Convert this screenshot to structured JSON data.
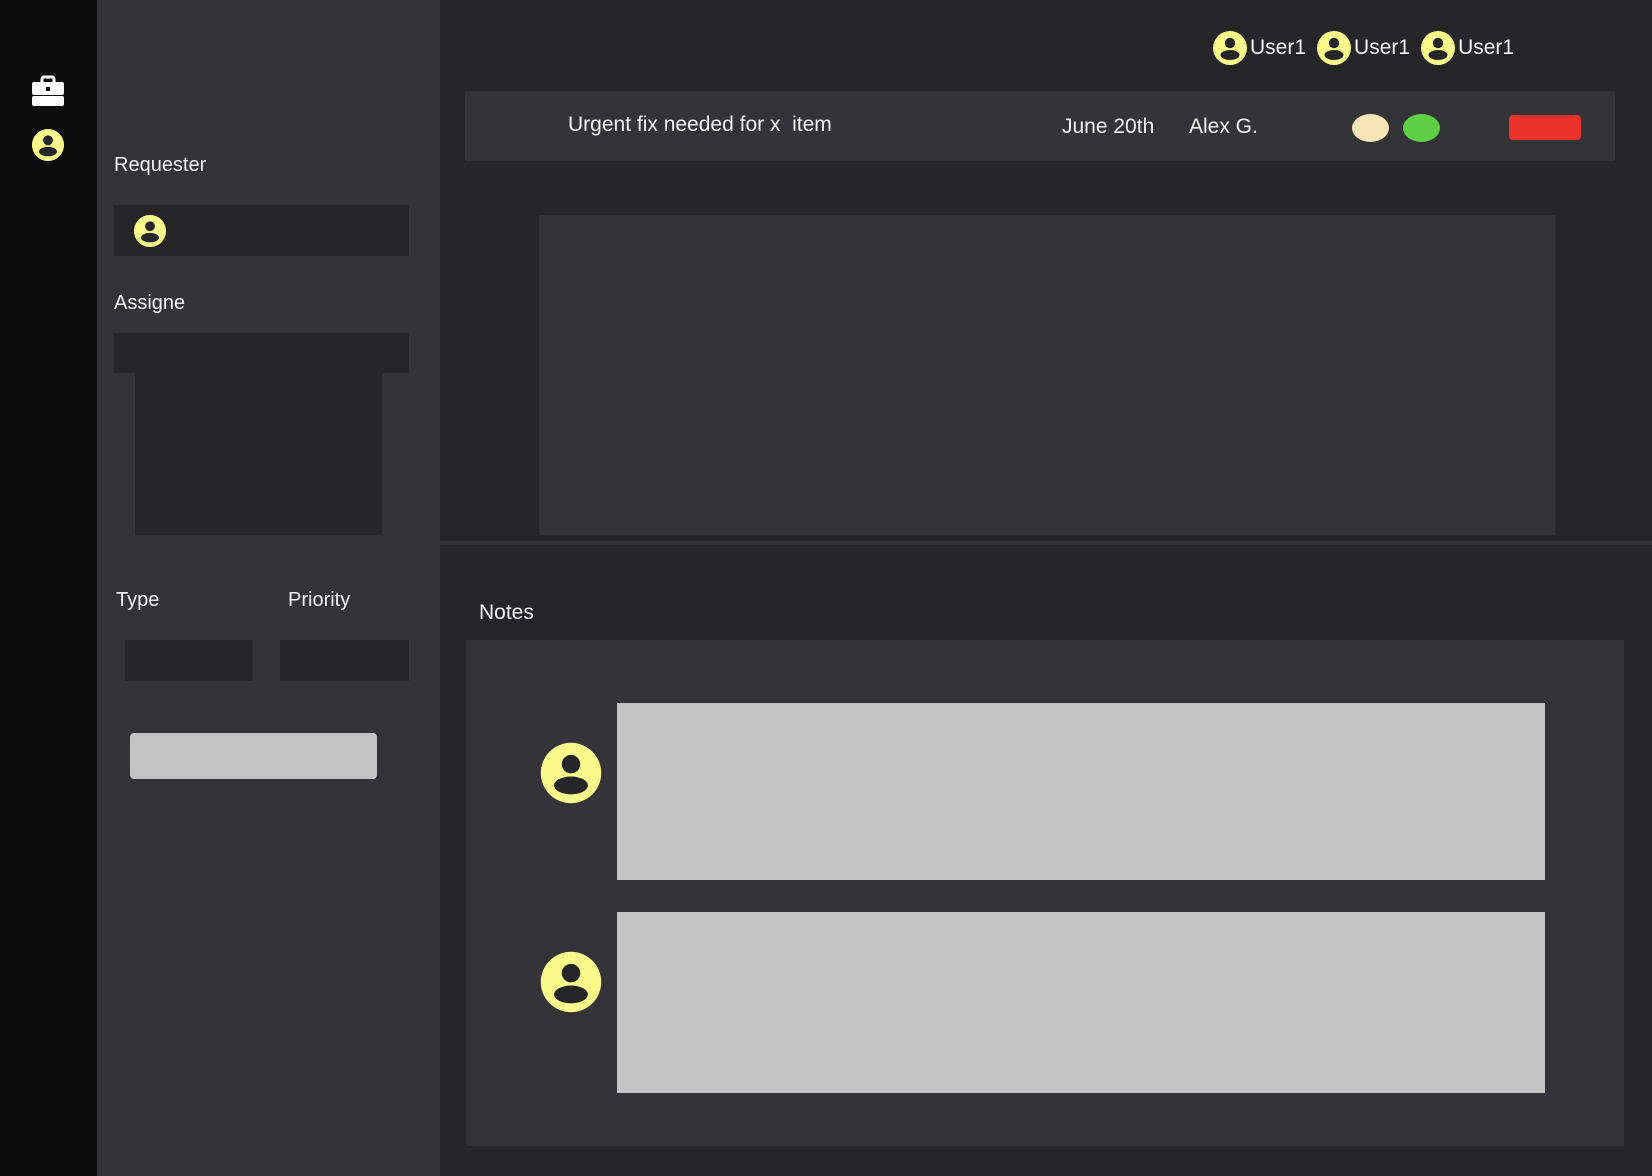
{
  "colors": {
    "rail_bg": "#0d0d0d",
    "panel_bg": "#343438",
    "canvas_bg": "#262629",
    "field_bg": "#262629",
    "avatar_yellow": "#fafa8c",
    "avatar_dark": "#262629",
    "status_cream": "#f7e6b5",
    "status_green": "#5dd046",
    "action_red": "#e8322a",
    "placeholder_gray": "#c4c4c4"
  },
  "rail": {
    "items": [
      {
        "icon": "briefcase-icon"
      },
      {
        "icon": "user-icon"
      }
    ]
  },
  "header": {
    "users": [
      {
        "label": "User1",
        "icon": "user-icon"
      },
      {
        "label": "User1",
        "icon": "user-icon"
      },
      {
        "label": "User1",
        "icon": "user-icon"
      }
    ]
  },
  "ticket": {
    "title": "Urgent fix needed for x  item",
    "date": "June 20th",
    "author": "Alex G."
  },
  "side": {
    "requester_label": "Requester",
    "assignee_label": "Assigne",
    "type_label": "Type",
    "priority_label": "Priority"
  },
  "notes": {
    "label": "Notes"
  }
}
